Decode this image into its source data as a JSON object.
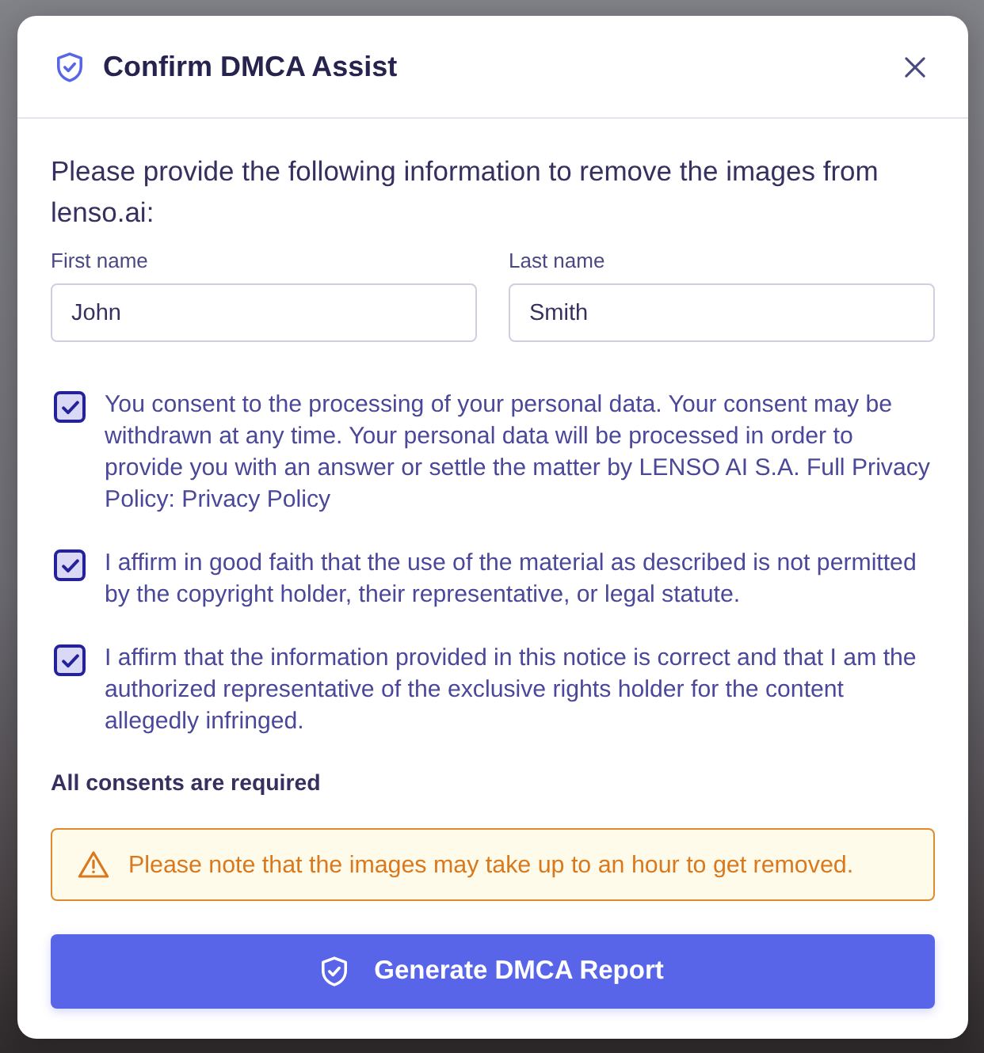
{
  "dialog": {
    "title": "Confirm DMCA Assist"
  },
  "intro": "Please provide the following information to remove the images from lenso.ai:",
  "fields": [
    {
      "label": "First name",
      "value": "John"
    },
    {
      "label": "Last name",
      "value": "Smith"
    }
  ],
  "consents": [
    {
      "text": "You consent to the processing of your personal data. Your consent may be withdrawn at any time. Your personal data will be processed in order to provide you with an answer or settle the matter by LENSO AI S.A. Full Privacy Policy: Privacy Policy",
      "checked": true
    },
    {
      "text": "I affirm in good faith that the use of the material as described is not permitted by the copyright holder, their representative, or legal statute.",
      "checked": true
    },
    {
      "text": "I affirm that the information provided in this notice is correct and that I am the authorized representative of the exclusive rights holder for the content allegedly infringed.",
      "checked": true
    }
  ],
  "requirement_note": "All consents are required",
  "warning": {
    "text": "Please note that the images may take up to an hour to get removed."
  },
  "primary_button": {
    "label": "Generate DMCA Report"
  }
}
